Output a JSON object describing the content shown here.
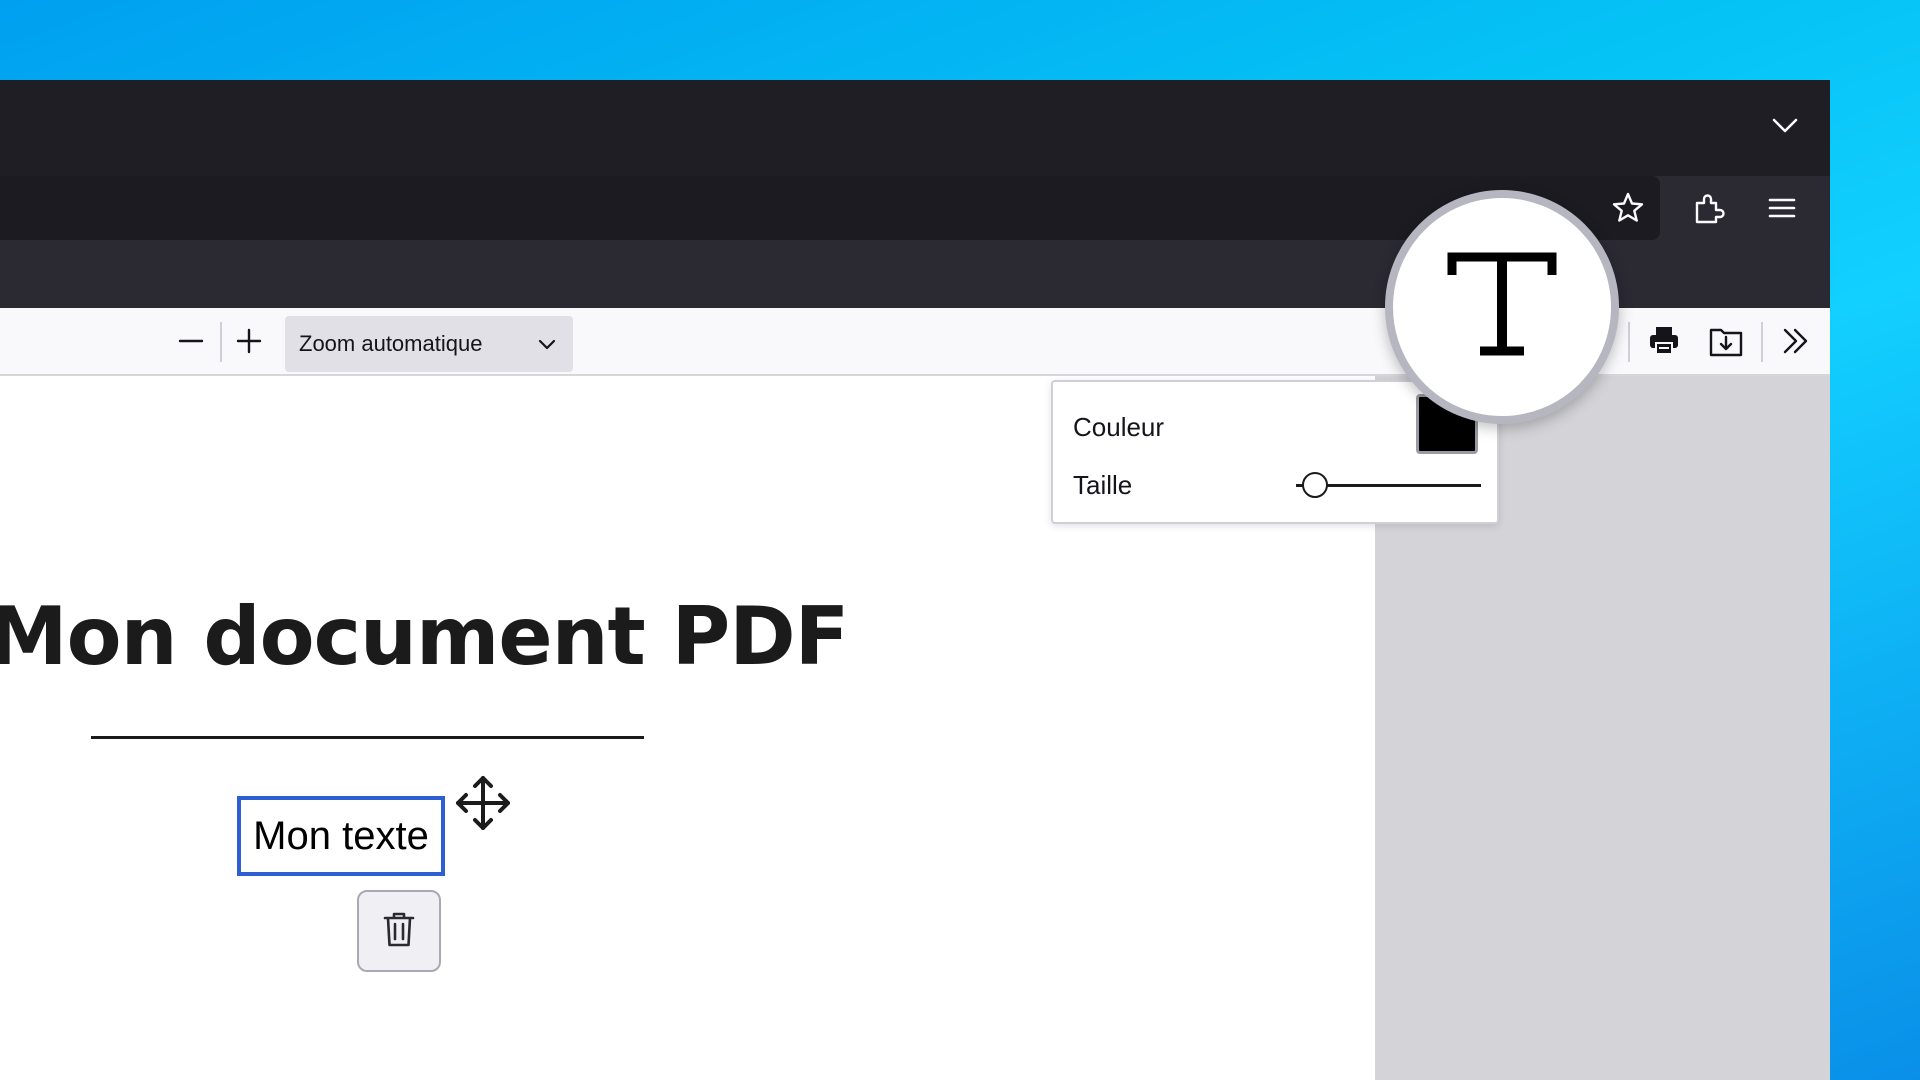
{
  "browser": {
    "icons": {
      "tabs_list": "chevron-down-icon",
      "bookmark": "star-icon",
      "extensions": "puzzle-icon",
      "menu": "hamburger-menu-icon"
    }
  },
  "pdf_toolbar": {
    "zoom_out_icon": "minus-icon",
    "zoom_in_icon": "plus-icon",
    "zoom_value": "Zoom automatique",
    "print_icon": "printer-icon",
    "save_icon": "download-icon",
    "more_tools_icon": "double-chevron-right-icon"
  },
  "document": {
    "title": "Mon document PDF",
    "text_annotation": "Mon texte"
  },
  "text_editor_popup": {
    "color_label": "Couleur",
    "color_value": "#000000",
    "size_label": "Taille",
    "size_level": 0.1
  },
  "magnifier": {
    "icon": "text-tool-icon",
    "letter": "T"
  },
  "colors": {
    "selection_border": "#2d5fd3",
    "browser_dark": "#1f1e25",
    "viewer_bg": "#d4d4d8"
  }
}
